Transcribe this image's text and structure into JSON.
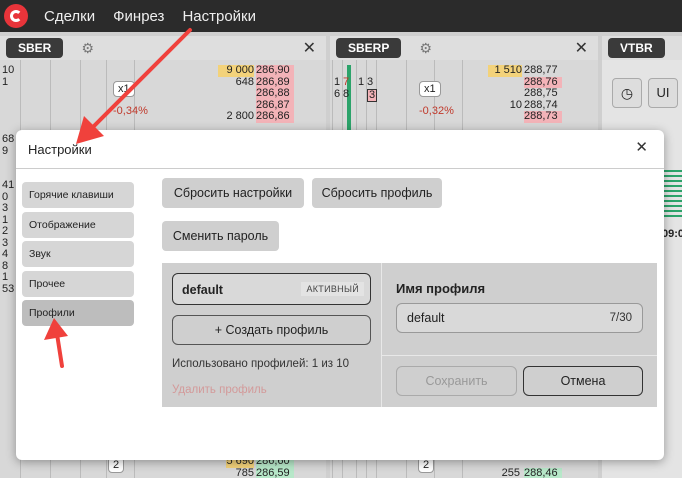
{
  "menubar": {
    "items": [
      "Сделки",
      "Финрез",
      "Настройки"
    ]
  },
  "panels": {
    "sber": {
      "ticker": "SBER",
      "multiplier": "x1",
      "change": "-0,34%",
      "volumes": [
        "9 000",
        "648",
        "",
        "",
        "2 800"
      ],
      "prices": [
        "286,90",
        "286,89",
        "286,88",
        "286,87",
        "286,86"
      ],
      "left_numbers": [
        "10",
        "1",
        "",
        "",
        "",
        "",
        "68",
        "9",
        "",
        "",
        "41",
        "0",
        "3",
        "1",
        "2",
        "3",
        "4",
        "8",
        "1",
        "53"
      ],
      "bottom_volumes": [
        "",
        "5 690",
        "785"
      ],
      "bottom_prices": [
        "",
        "286,60",
        "286,59"
      ],
      "bottom_pill": "2"
    },
    "sberp": {
      "ticker": "SBERP",
      "multiplier": "x1",
      "change": "-0,32%",
      "volumes": [
        "",
        "1 510",
        "",
        "",
        "10"
      ],
      "prices": [
        "288,77",
        "288,76",
        "288,75",
        "288,74",
        "288,73"
      ],
      "bottom_volumes": [
        "",
        "255"
      ],
      "bottom_prices": [
        "",
        "288,46"
      ],
      "bottom_pill": "2",
      "mini_cols": [
        "1",
        "7",
        "1",
        "3",
        "6",
        "8",
        "3"
      ]
    },
    "vtbr": {
      "ticker": "VTBR",
      "hint": "UI",
      "time": "09:0"
    }
  },
  "dialog": {
    "title": "Настройки",
    "sidebar": [
      "Горячие клавиши",
      "Отображение",
      "Звук",
      "Прочее",
      "Профили"
    ],
    "active_index": 4,
    "buttons": {
      "reset_settings": "Сбросить настройки",
      "reset_profile": "Сбросить профиль",
      "change_password": "Сменить пароль"
    },
    "profiles": {
      "current_name": "default",
      "current_tag": "АКТИВНЫЙ",
      "create_label": "+ Создать профиль",
      "usage": "Использовано профилей: 1 из 10",
      "delete_label": "Удалить профиль"
    },
    "profile_form": {
      "label": "Имя профиля",
      "value": "default",
      "counter": "7/30",
      "save_label": "Сохранить",
      "cancel_label": "Отмена"
    }
  },
  "colors": {
    "accent_red": "#e8343a",
    "arrow": "#f0413c",
    "menubar_bg": "#2b2b2b"
  }
}
